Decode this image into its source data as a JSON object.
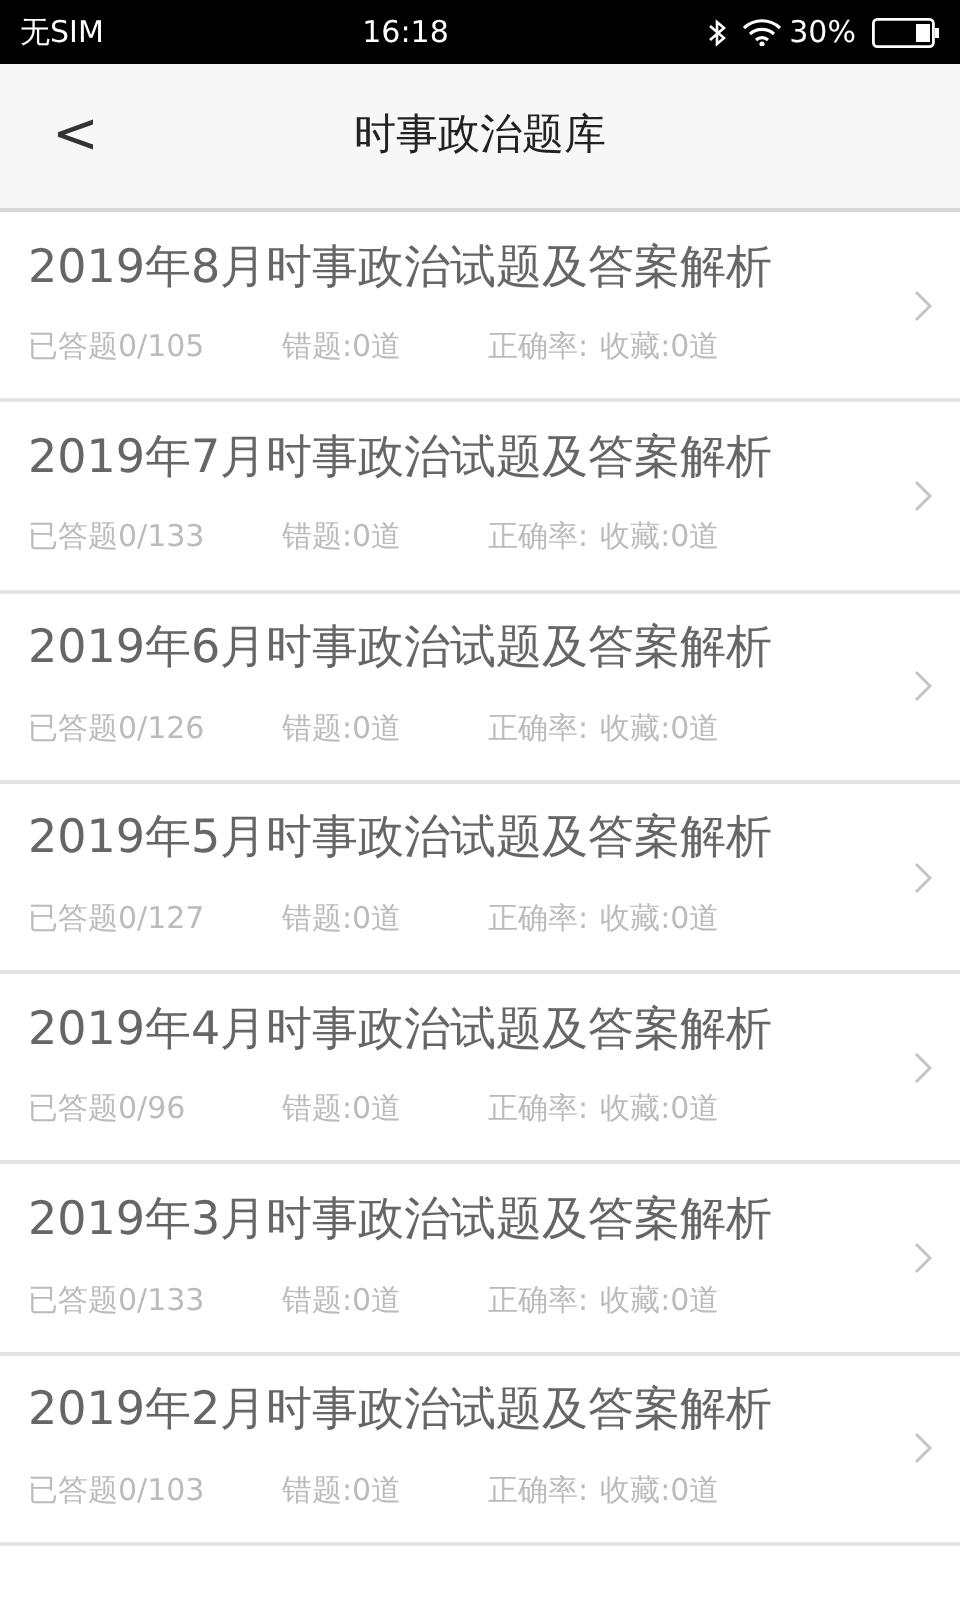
{
  "status_bar": {
    "carrier": "无SIM",
    "time": "16:18",
    "battery": "30%"
  },
  "header": {
    "back": "<",
    "title": "时事政治题库"
  },
  "items": [
    {
      "title": "2019年8月时事政治试题及答案解析",
      "answered": "已答题0/105",
      "wrong": "错题:0道",
      "accuracy": "正确率:",
      "favorites": "收藏:0道"
    },
    {
      "title": "2019年7月时事政治试题及答案解析",
      "answered": "已答题0/133",
      "wrong": "错题:0道",
      "accuracy": "正确率:",
      "favorites": "收藏:0道"
    },
    {
      "title": "2019年6月时事政治试题及答案解析",
      "answered": "已答题0/126",
      "wrong": "错题:0道",
      "accuracy": "正确率:",
      "favorites": "收藏:0道"
    },
    {
      "title": "2019年5月时事政治试题及答案解析",
      "answered": "已答题0/127",
      "wrong": "错题:0道",
      "accuracy": "正确率:",
      "favorites": "收藏:0道"
    },
    {
      "title": "2019年4月时事政治试题及答案解析",
      "answered": "已答题0/96",
      "wrong": "错题:0道",
      "accuracy": "正确率:",
      "favorites": "收藏:0道"
    },
    {
      "title": "2019年3月时事政治试题及答案解析",
      "answered": "已答题0/133",
      "wrong": "错题:0道",
      "accuracy": "正确率:",
      "favorites": "收藏:0道"
    },
    {
      "title": "2019年2月时事政治试题及答案解析",
      "answered": "已答题0/103",
      "wrong": "错题:0道",
      "accuracy": "正确率:",
      "favorites": "收藏:0道"
    }
  ]
}
